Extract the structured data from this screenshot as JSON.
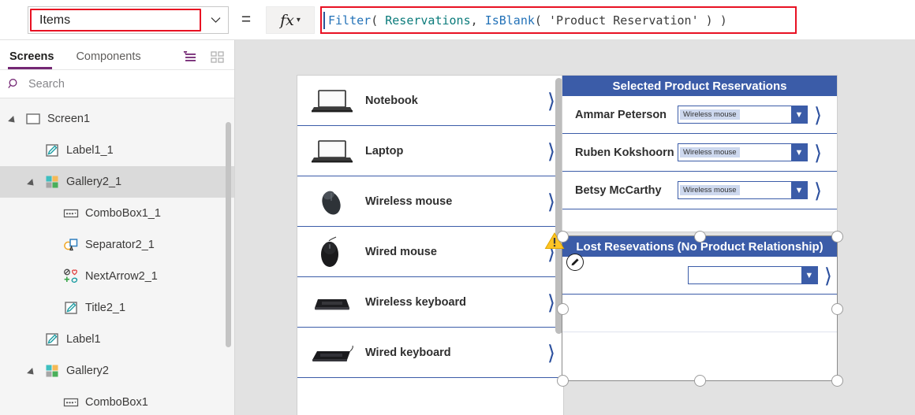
{
  "formula_bar": {
    "property_value": "Items",
    "property_dropdown_icon": "chevron-down-icon",
    "equals": "=",
    "fx_label": "fx",
    "fx_dropdown_icon": "chevron-down-icon",
    "formula_tokens": [
      {
        "text": "Filter",
        "type": "fn"
      },
      {
        "text": "( ",
        "type": "pun"
      },
      {
        "text": "Reservations",
        "type": "tbl"
      },
      {
        "text": ", ",
        "type": "pun"
      },
      {
        "text": "IsBlank",
        "type": "fn"
      },
      {
        "text": "( ",
        "type": "pun"
      },
      {
        "text": "'Product Reservation'",
        "type": "str"
      },
      {
        "text": " ) )",
        "type": "pun"
      }
    ],
    "formula_plain": "Filter( Reservations, IsBlank( 'Product Reservation' ) )",
    "highlight_color": "#e81123"
  },
  "left_panel": {
    "tabs": [
      {
        "label": "Screens",
        "active": true
      },
      {
        "label": "Components",
        "active": false
      }
    ],
    "tab_icons": [
      {
        "name": "tree-view-icon"
      },
      {
        "name": "thumbnail-view-icon"
      }
    ],
    "accent_color": "#742774",
    "search": {
      "placeholder": "Search",
      "value": "",
      "icon": "search-icon"
    },
    "tree": [
      {
        "label": "Screen1",
        "indent": 0,
        "caret": true,
        "icon": "screen-icon",
        "selected": false
      },
      {
        "label": "Label1_1",
        "indent": 1,
        "caret": false,
        "icon": "label-icon",
        "selected": false
      },
      {
        "label": "Gallery2_1",
        "indent": 1,
        "caret": true,
        "icon": "gallery-icon",
        "selected": true
      },
      {
        "label": "ComboBox1_1",
        "indent": 2,
        "caret": false,
        "icon": "combobox-icon",
        "selected": false
      },
      {
        "label": "Separator2_1",
        "indent": 2,
        "caret": false,
        "icon": "shapes-icon",
        "selected": false
      },
      {
        "label": "NextArrow2_1",
        "indent": 2,
        "caret": false,
        "icon": "icons-icon",
        "selected": false
      },
      {
        "label": "Title2_1",
        "indent": 2,
        "caret": false,
        "icon": "label-icon",
        "selected": false
      },
      {
        "label": "Label1",
        "indent": 1,
        "caret": false,
        "icon": "label-icon",
        "selected": false
      },
      {
        "label": "Gallery2",
        "indent": 1,
        "caret": true,
        "icon": "gallery-icon",
        "selected": false
      },
      {
        "label": "ComboBox1",
        "indent": 2,
        "caret": false,
        "icon": "combobox-icon",
        "selected": false
      }
    ]
  },
  "canvas": {
    "product_gallery": {
      "items": [
        {
          "name": "Notebook",
          "thumb": "notebook-image"
        },
        {
          "name": "Laptop",
          "thumb": "laptop-image"
        },
        {
          "name": "Wireless mouse",
          "thumb": "wireless-mouse-image"
        },
        {
          "name": "Wired mouse",
          "thumb": "wired-mouse-image"
        },
        {
          "name": "Wireless keyboard",
          "thumb": "wireless-keyboard-image"
        },
        {
          "name": "Wired keyboard",
          "thumb": "wired-keyboard-image"
        }
      ],
      "chevron_icon": "chevron-right-icon",
      "accent_color": "#3b5ca8"
    },
    "selected_reservations": {
      "title": "Selected Product Reservations",
      "rows": [
        {
          "person": "Ammar Peterson",
          "combo_value": "Wireless mouse"
        },
        {
          "person": "Ruben Kokshoorn",
          "combo_value": "Wireless mouse"
        },
        {
          "person": "Betsy McCarthy",
          "combo_value": "Wireless mouse"
        }
      ],
      "header_color": "#3b5ca8"
    },
    "lost_reservations": {
      "title": "Lost Resevations (No Product Relationship)",
      "rows": [
        {
          "person": "",
          "combo_value": ""
        }
      ],
      "warning_icon": "warning-triangle-icon",
      "edit_icon": "edit-pencil-icon",
      "header_color": "#3b5ca8",
      "selected": true
    }
  }
}
